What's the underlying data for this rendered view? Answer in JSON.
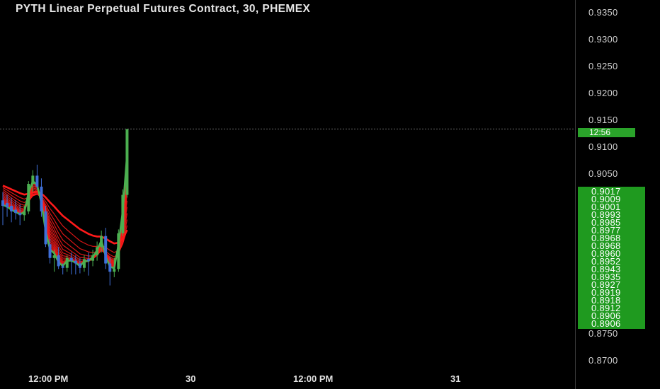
{
  "header": {
    "title": "PYTH Linear Perpetual Futures Contract, 30, PHEMEX"
  },
  "price_axis": {
    "ticks": [
      "0.9350",
      "0.9300",
      "0.9250",
      "0.9200",
      "0.9150",
      "0.9100",
      "0.9050",
      "0.8750",
      "0.8700"
    ],
    "band_labels": [
      "0.9017",
      "0.9009",
      "0.9001",
      "0.8993",
      "0.8985",
      "0.8977",
      "0.8968",
      "0.8968",
      "0.8960",
      "0.8952",
      "0.8943",
      "0.8935",
      "0.8927",
      "0.8919",
      "0.8918",
      "0.8912",
      "0.8906",
      "0.8906"
    ],
    "countdown": "12:56",
    "band_color": "#1f9a1f"
  },
  "time_axis": {
    "labels": [
      "12:00 PM",
      "30",
      "12:00 PM",
      "31"
    ]
  },
  "colors": {
    "up_candle": "#4caf50",
    "down_candle": "#3f6fd8",
    "ribbon_slow": "#ff1a1a",
    "ribbon_fast": "#4caf50",
    "background": "#000000"
  },
  "chart_data": {
    "type": "candlestick",
    "title": "PYTH Linear Perpetual Futures Contract, 30, PHEMEX",
    "ylim": [
      0.869,
      0.936
    ],
    "last_price": 0.9125,
    "candles": [
      {
        "o": 0.8995,
        "h": 0.901,
        "l": 0.895,
        "c": 0.8985
      },
      {
        "o": 0.899,
        "h": 0.9005,
        "l": 0.8965,
        "c": 0.8982
      },
      {
        "o": 0.8985,
        "h": 0.9,
        "l": 0.8955,
        "c": 0.8975
      },
      {
        "o": 0.8978,
        "h": 0.8995,
        "l": 0.896,
        "c": 0.8972
      },
      {
        "o": 0.8972,
        "h": 0.8988,
        "l": 0.895,
        "c": 0.8968
      },
      {
        "o": 0.8968,
        "h": 0.8985,
        "l": 0.8958,
        "c": 0.8975
      },
      {
        "o": 0.8975,
        "h": 0.903,
        "l": 0.897,
        "c": 0.9025
      },
      {
        "o": 0.9025,
        "h": 0.905,
        "l": 0.901,
        "c": 0.904
      },
      {
        "o": 0.904,
        "h": 0.906,
        "l": 0.9015,
        "c": 0.902
      },
      {
        "o": 0.902,
        "h": 0.9035,
        "l": 0.8965,
        "c": 0.8975
      },
      {
        "o": 0.8975,
        "h": 0.8985,
        "l": 0.891,
        "c": 0.8915
      },
      {
        "o": 0.8915,
        "h": 0.8925,
        "l": 0.888,
        "c": 0.889
      },
      {
        "o": 0.889,
        "h": 0.8905,
        "l": 0.8865,
        "c": 0.8895
      },
      {
        "o": 0.8895,
        "h": 0.891,
        "l": 0.887,
        "c": 0.8875
      },
      {
        "o": 0.8875,
        "h": 0.888,
        "l": 0.886,
        "c": 0.8872
      },
      {
        "o": 0.8872,
        "h": 0.8895,
        "l": 0.8865,
        "c": 0.889
      },
      {
        "o": 0.889,
        "h": 0.89,
        "l": 0.886,
        "c": 0.8885
      },
      {
        "o": 0.8885,
        "h": 0.8895,
        "l": 0.886,
        "c": 0.888
      },
      {
        "o": 0.888,
        "h": 0.889,
        "l": 0.8862,
        "c": 0.8872
      },
      {
        "o": 0.8872,
        "h": 0.8895,
        "l": 0.8865,
        "c": 0.8888
      },
      {
        "o": 0.8888,
        "h": 0.89,
        "l": 0.8858,
        "c": 0.8885
      },
      {
        "o": 0.8885,
        "h": 0.8905,
        "l": 0.8875,
        "c": 0.8895
      },
      {
        "o": 0.8895,
        "h": 0.892,
        "l": 0.8885,
        "c": 0.891
      },
      {
        "o": 0.891,
        "h": 0.894,
        "l": 0.89,
        "c": 0.893
      },
      {
        "o": 0.893,
        "h": 0.8945,
        "l": 0.887,
        "c": 0.888
      },
      {
        "o": 0.888,
        "h": 0.8892,
        "l": 0.884,
        "c": 0.8865
      },
      {
        "o": 0.8865,
        "h": 0.889,
        "l": 0.8855,
        "c": 0.887
      },
      {
        "o": 0.887,
        "h": 0.8942,
        "l": 0.8865,
        "c": 0.8935
      },
      {
        "o": 0.8935,
        "h": 0.9015,
        "l": 0.893,
        "c": 0.9005
      },
      {
        "o": 0.9005,
        "h": 0.9125,
        "l": 0.9,
        "c": 0.9125
      }
    ],
    "ribbon": {
      "count": 16,
      "slow_period_level_end": 0.9017,
      "fast_period_level_end": 0.8906
    }
  }
}
